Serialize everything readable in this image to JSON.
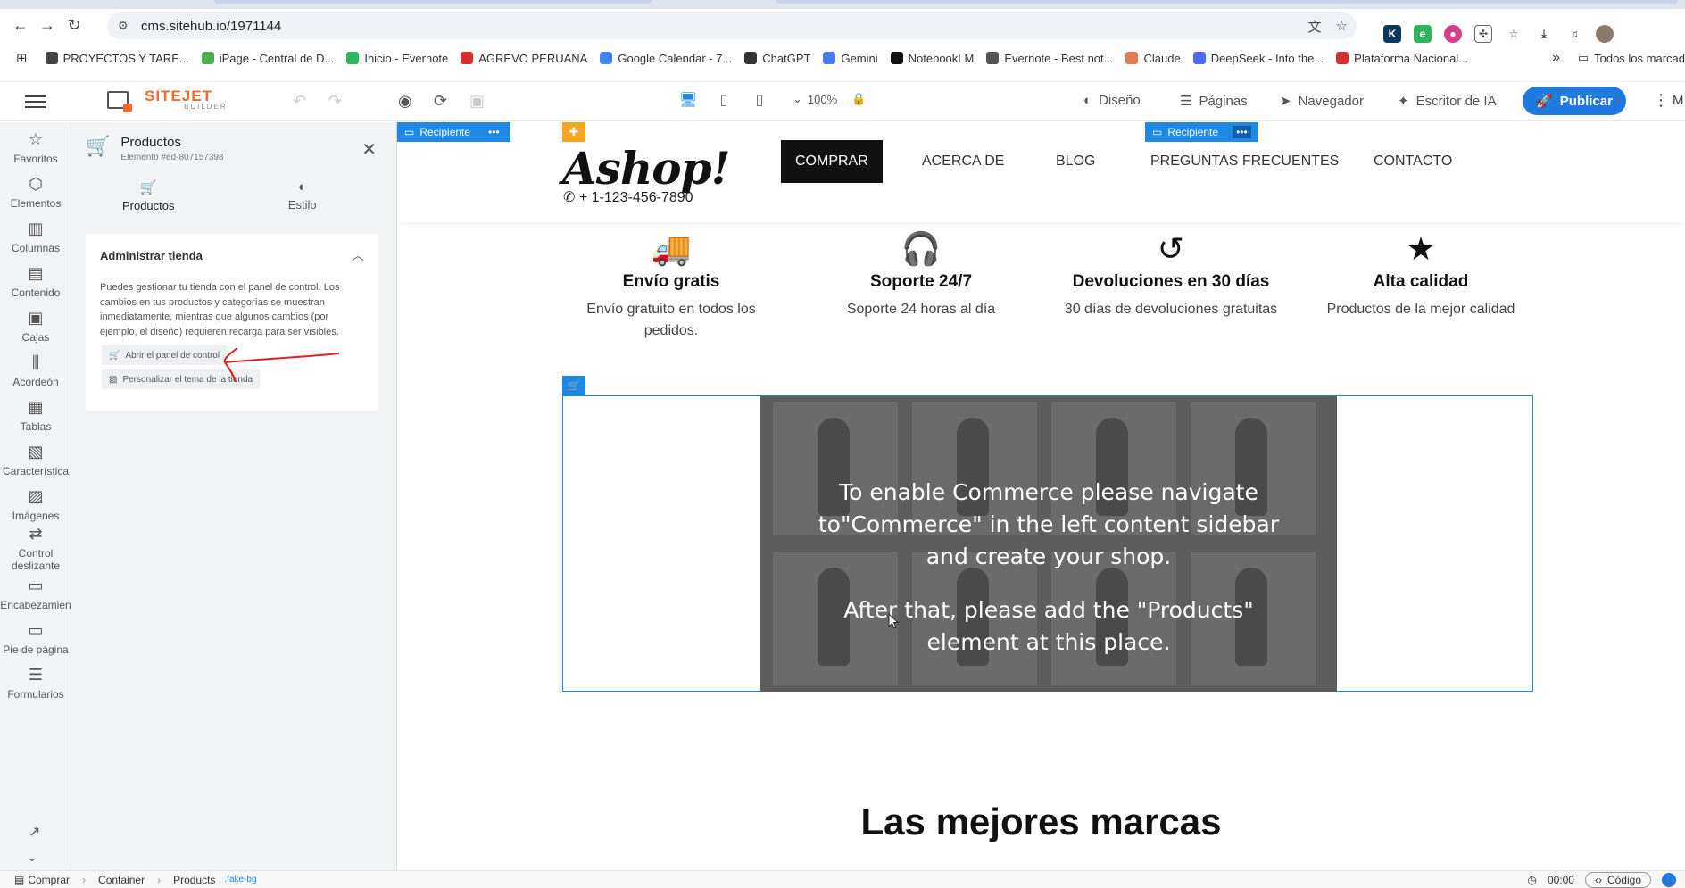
{
  "browser": {
    "url": "cms.sitehub.io/1971144",
    "bookmarks": [
      {
        "label": "PROYECTOS Y TARE...",
        "color": "#444444"
      },
      {
        "label": "iPage - Central de D...",
        "color": "#4caf50"
      },
      {
        "label": "Inicio - Evernote",
        "color": "#2db55d"
      },
      {
        "label": "AGREVO PERUANA",
        "color": "#d32f2f"
      },
      {
        "label": "Google Calendar - 7...",
        "color": "#4285f4"
      },
      {
        "label": "ChatGPT",
        "color": "#333333"
      },
      {
        "label": "Gemini",
        "color": "#4a7cf0"
      },
      {
        "label": "NotebookLM",
        "color": "#111111"
      },
      {
        "label": "Evernote - Best not...",
        "color": "#555555"
      },
      {
        "label": "Claude",
        "color": "#e07b53"
      },
      {
        "label": "DeepSeek - Into the...",
        "color": "#4d6bfe"
      },
      {
        "label": "Plataforma Nacional...",
        "color": "#d32f2f"
      }
    ],
    "bookmarks_more": "»",
    "bookmarks_all": "Todos los marcad"
  },
  "toolbar": {
    "logo_title": "SITEJET",
    "logo_sub": "BUILDER",
    "zoom": "100%",
    "design": "Diseño",
    "pages": "Páginas",
    "navigator": "Navegador",
    "ai_writer": "Escritor de IA",
    "publish": "Publicar",
    "more": "M"
  },
  "rail": [
    {
      "label": "Favoritos",
      "icon": "☆"
    },
    {
      "label": "Elementos",
      "icon": "⬡"
    },
    {
      "label": "Columnas",
      "icon": "▥"
    },
    {
      "label": "Contenido",
      "icon": "▤"
    },
    {
      "label": "Cajas",
      "icon": "▣"
    },
    {
      "label": "Acordeón",
      "icon": "⫼"
    },
    {
      "label": "Tablas",
      "icon": "▦"
    },
    {
      "label": "Característica",
      "icon": "▧"
    },
    {
      "label": "Imágenes",
      "icon": "▨"
    },
    {
      "label": "Control deslizante",
      "icon": "⇄"
    },
    {
      "label": "Encabezamien",
      "icon": "▭"
    },
    {
      "label": "Pie de página",
      "icon": "▭"
    },
    {
      "label": "Formularios",
      "icon": "☰"
    }
  ],
  "panel": {
    "title": "Productos",
    "subtitle": "Elemento #ed-807157398",
    "tabs": [
      {
        "label": "Productos"
      },
      {
        "label": "Estilo"
      }
    ],
    "card_title": "Administrar tienda",
    "card_text": "Puedes gestionar tu tienda con el panel de control. Los cambios en tus productos y categorías se muestran inmediatamente, mientras que algunos cambios (por ejemplo, el diseño) requieren recarga para ser visibles.",
    "btn_dashboard": "Abrir el panel de control",
    "btn_theme": "Personalizar el tema de la tienda"
  },
  "canvas": {
    "recipient_label": "Recipiente",
    "brand": "Ashop!",
    "phone": "+ 1-123-456-7890",
    "nav": [
      "COMPRAR",
      "ACERCA DE",
      "BLOG",
      "PREGUNTAS FRECUENTES",
      "CONTACTO"
    ],
    "features": [
      {
        "icon": "🚚",
        "title": "Envío gratis",
        "desc": "Envío gratuito en todos los pedidos."
      },
      {
        "icon": "🎧",
        "title": "Soporte 24/7",
        "desc": "Soporte 24 horas al día"
      },
      {
        "icon": "↺",
        "title": "Devoluciones en 30 días",
        "desc": "30 días de devoluciones gratuitas"
      },
      {
        "icon": "★",
        "title": "Alta calidad",
        "desc": "Productos de la mejor calidad"
      }
    ],
    "commerce_line1": "To enable Commerce please navigate",
    "commerce_line2": "to\"Commerce\" in the left content sidebar",
    "commerce_line3": "and create your shop.",
    "commerce_line4": "After that, please add the \"Products\"",
    "commerce_line5": "element at this place.",
    "section_title": "Las mejores marcas"
  },
  "statusbar": {
    "crumbs": [
      "Comprar",
      "Container",
      "Products"
    ],
    "crumb_class": ".fake-bg",
    "time": "00:00",
    "code": "Código"
  }
}
